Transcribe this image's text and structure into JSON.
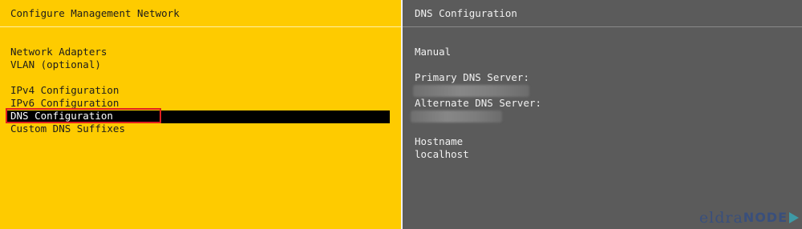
{
  "left_panel": {
    "title": "Configure Management Network",
    "menu_items": [
      "Network Adapters",
      "VLAN (optional)",
      "IPv4 Configuration",
      "IPv6 Configuration",
      "DNS Configuration",
      "Custom DNS Suffixes"
    ],
    "selected_index": 4
  },
  "right_panel": {
    "title": "DNS Configuration",
    "mode": "Manual",
    "primary_dns_label": "Primary DNS Server:",
    "alternate_dns_label": "Alternate DNS Server:",
    "hostname_label": "Hostname",
    "hostname_value": "localhost"
  },
  "watermark": {
    "text_part1": "eldra",
    "text_part2": "NODE"
  },
  "colors": {
    "left_background": "#fecb00",
    "right_background": "#5b5b5b",
    "selection": "#000000",
    "highlight_box": "#e02020"
  }
}
